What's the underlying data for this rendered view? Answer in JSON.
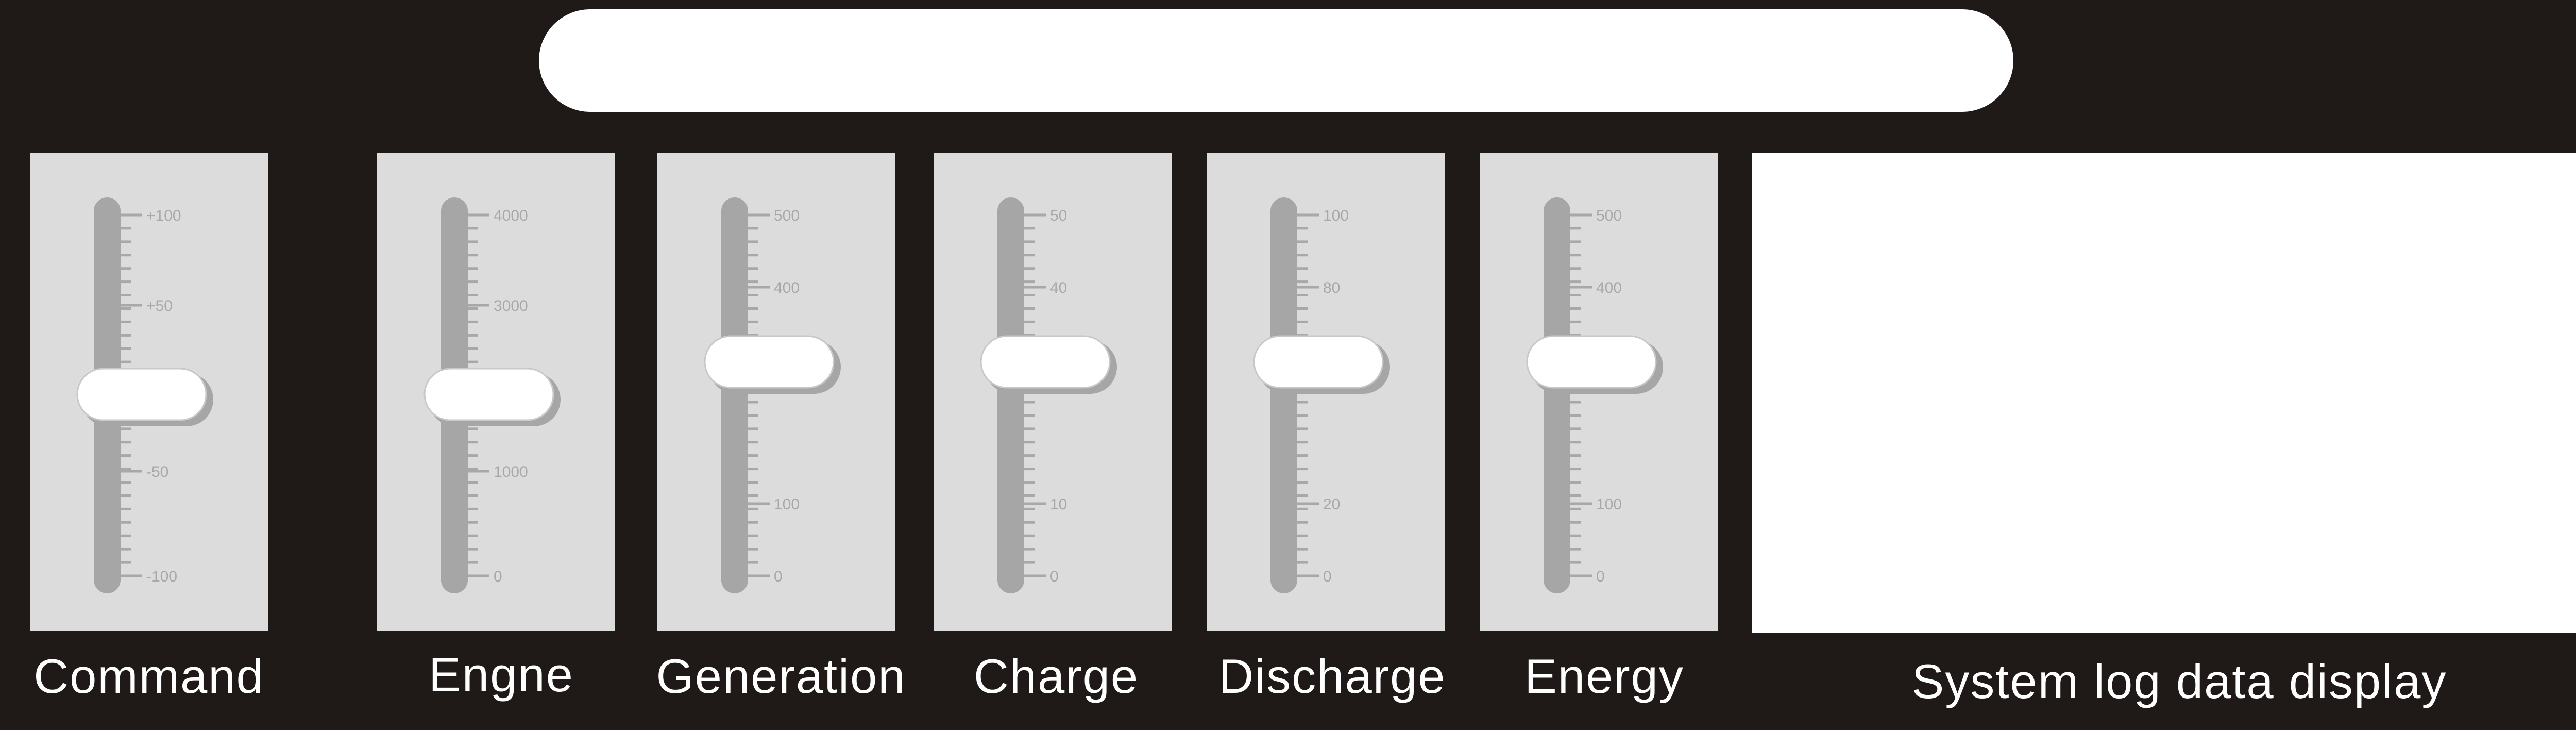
{
  "title_bar": {
    "text": ""
  },
  "sliders": [
    {
      "id": "command",
      "label": "Command",
      "ticks": [
        "+100",
        "+50",
        "-50",
        "-100"
      ],
      "value_fraction": 0.5
    },
    {
      "id": "engine",
      "label": "Engne",
      "ticks": [
        "4000",
        "3000",
        "1000",
        "0"
      ],
      "value_fraction": 0.5
    },
    {
      "id": "generation",
      "label": "Generation",
      "ticks": [
        "500",
        "400",
        "300",
        "100",
        "0"
      ],
      "value_fraction": 0.41
    },
    {
      "id": "charge",
      "label": "Charge",
      "ticks": [
        "50",
        "40",
        "30",
        "10",
        "0"
      ],
      "value_fraction": 0.41
    },
    {
      "id": "discharge",
      "label": "Discharge",
      "ticks": [
        "100",
        "80",
        "60",
        "20",
        "0"
      ],
      "value_fraction": 0.41
    },
    {
      "id": "energy",
      "label": "Energy",
      "ticks": [
        "500",
        "400",
        "300",
        "100",
        "0"
      ],
      "value_fraction": 0.41
    }
  ],
  "log": {
    "label": "System log data display",
    "content": ""
  },
  "colors": {
    "background": "#1f1a17",
    "panel": "#dcdcdc",
    "track": "#a6a6a6",
    "tick": "#a8a8a8",
    "thumb": "#ffffff",
    "label": "#ffffff"
  }
}
